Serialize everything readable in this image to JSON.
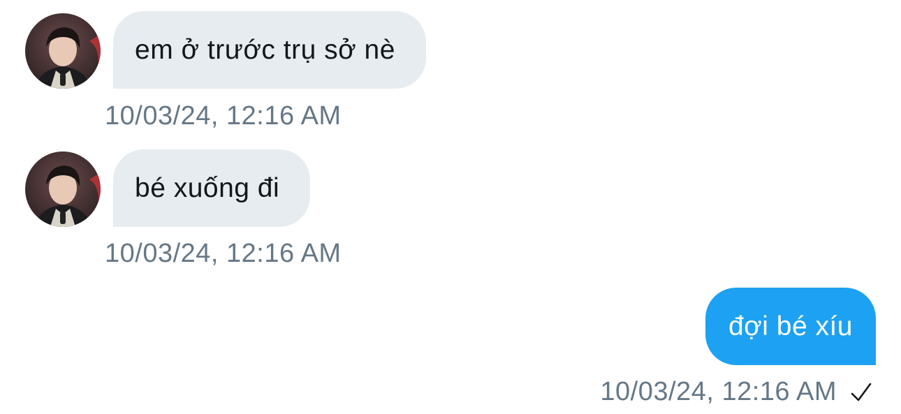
{
  "messages": [
    {
      "direction": "incoming",
      "text": "em ở trước trụ sở nè",
      "timestamp": "10/03/24, 12:16 AM"
    },
    {
      "direction": "incoming",
      "text": "bé xuống đi",
      "timestamp": "10/03/24, 12:16 AM"
    },
    {
      "direction": "outgoing",
      "text": "đợi bé xíu",
      "timestamp": "10/03/24, 12:16 AM"
    }
  ],
  "colors": {
    "incoming_bubble": "#e6ecf0",
    "outgoing_bubble": "#1da1f2",
    "timestamp_text": "#657786",
    "incoming_text": "#14171a",
    "outgoing_text": "#ffffff"
  },
  "icons": {
    "avatar": "profile-photo",
    "read_status": "check-icon"
  }
}
